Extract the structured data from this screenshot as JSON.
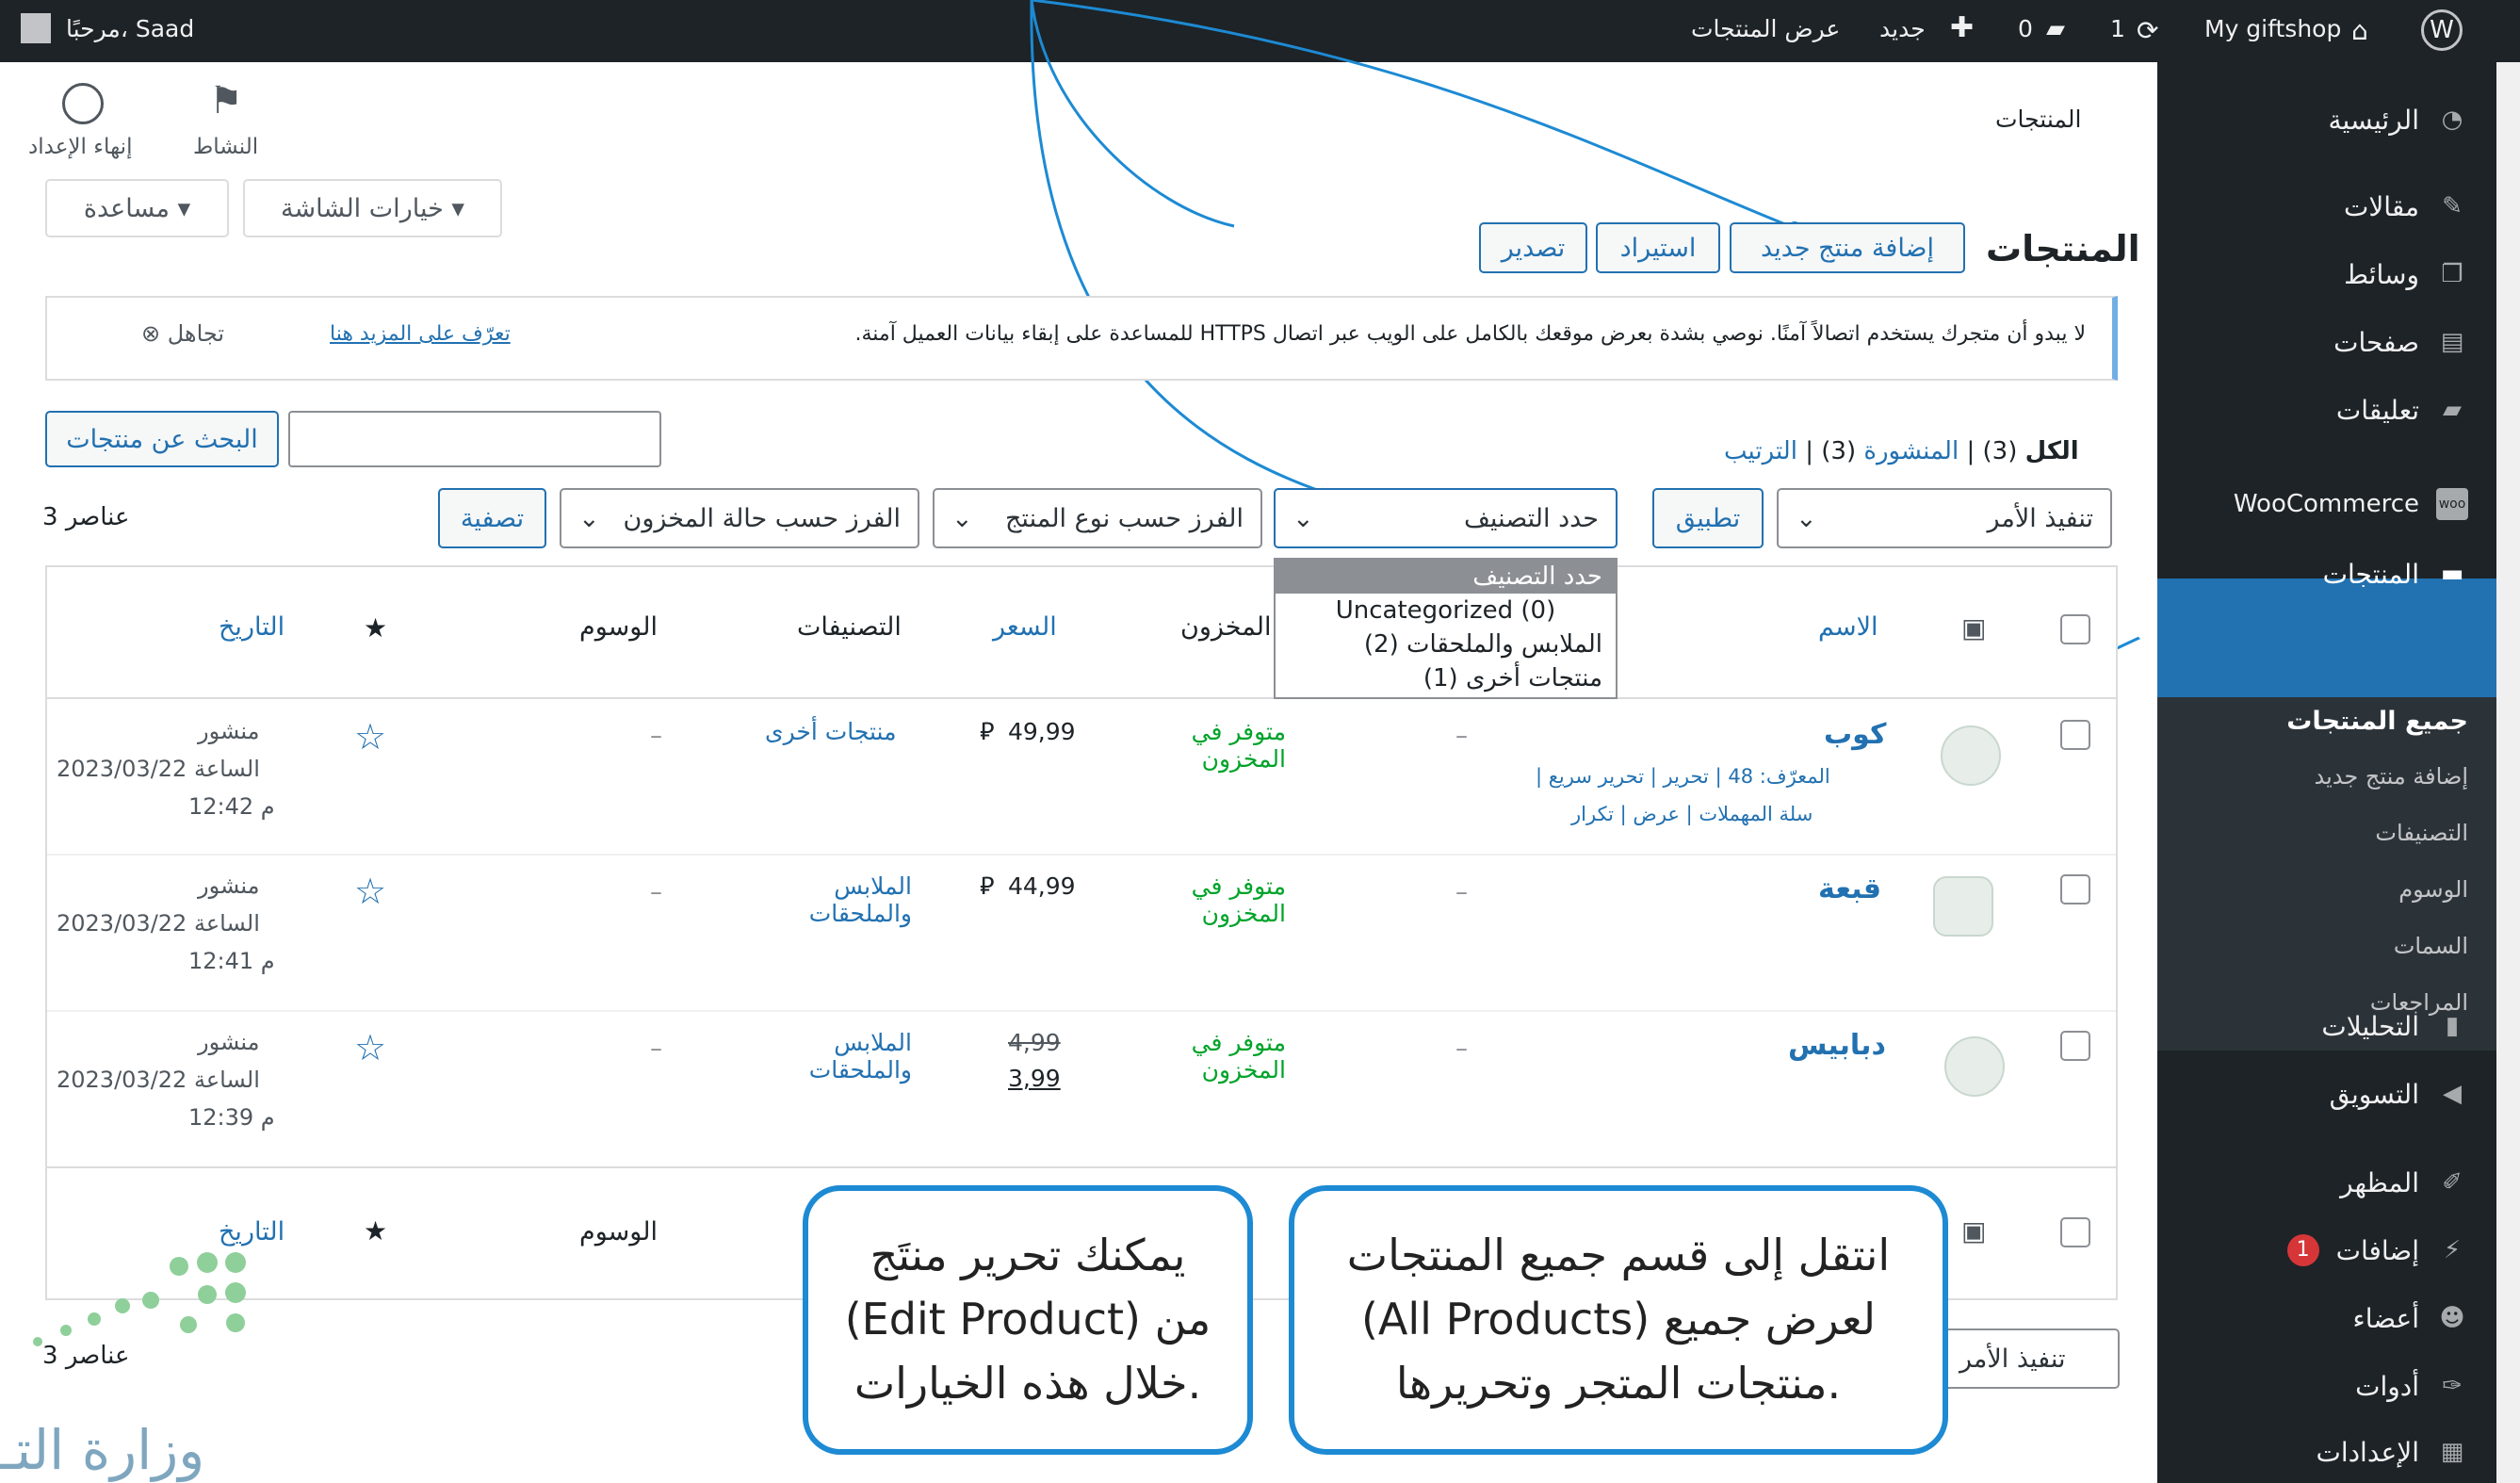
{
  "adminbar": {
    "wp_logo": "wordpress-icon",
    "site_name": "My giftshop",
    "updates": "1",
    "comments": "0",
    "new_label": "جديد",
    "view_products": "عرض المنتجات",
    "greeting": "مرحبًا، Saad"
  },
  "header": {
    "page_title": "المنتجات",
    "activity_label": "النشاط",
    "finish_setup_label": "إنهاء الإعداد",
    "screen_options": "خيارات الشاشة ▾",
    "help": "مساعدة ▾"
  },
  "main": {
    "heading": "المنتجات",
    "add_new": "إضافة منتج جديد",
    "import": "استيراد",
    "export": "تصدير",
    "notice_text": "لا يبدو أن متجرك يستخدم اتصالاً آمنًا. نوصي بشدة بعرض موقعك بالكامل على الويب عبر اتصال HTTPS للمساعدة على إبقاء بيانات العميل آمنة.",
    "notice_link": "تعرّف على المزيد هنا",
    "dismiss": "تجاهل",
    "search_button": "البحث عن منتجات",
    "search_value": "",
    "filter_all": "الكل",
    "filter_all_count": "(3)",
    "filter_published": "المنشورة",
    "filter_published_count": "(3)",
    "filter_sort": "الترتيب",
    "bulk_action": "تنفيذ الأمر",
    "apply": "تطبيق",
    "category_select": "حدد التصنيف",
    "type_select": "الفرز حسب نوع المنتج",
    "stock_select": "الفرز حسب حالة المخزون",
    "filter_button": "تصفية",
    "items_count": "3 عناصر",
    "items_count_bottom": "3 عناصر"
  },
  "dropdown": {
    "options": [
      {
        "label": "حدد التصنيف"
      },
      {
        "label": "Uncategorized  (0)"
      },
      {
        "label": "الملابس والملحقات  (2)"
      },
      {
        "label": "منتجات أخرى  (1)"
      }
    ]
  },
  "table": {
    "columns": {
      "name": "الاسم",
      "stock": "المخزون",
      "price": "السعر",
      "categories": "التصنيفات",
      "tags": "الوسوم",
      "date": "التاريخ"
    },
    "rows": [
      {
        "name": "كوب",
        "row_actions_1": "المعرّف: 48 | تحرير | تحرير سريع |",
        "row_actions_2": "سلة المهملات | عرض | تكرار",
        "sku": "–",
        "stock": "متوفر في المخزون",
        "price": "49,99",
        "category": "منتجات أخرى",
        "tags": "–",
        "status": "منشور",
        "date": "2023/03/22 الساعة",
        "time": "12:42 م"
      },
      {
        "name": "قبعة",
        "sku": "–",
        "stock": "متوفر في المخزون",
        "price": "44,99",
        "category": "الملابس والملحقات",
        "tags": "–",
        "status": "منشور",
        "date": "2023/03/22 الساعة",
        "time": "12:41 م"
      },
      {
        "name": "دبابيس",
        "sku": "–",
        "stock": "متوفر في المخزون",
        "price_old": "4,99",
        "price": "3,99",
        "category": "الملابس والملحقات",
        "tags": "–",
        "status": "منشور",
        "date": "2023/03/22 الساعة",
        "time": "12:39 م"
      }
    ],
    "currency_symbol": "⃁"
  },
  "sidebar": {
    "items": [
      {
        "label": "الرئيسية",
        "icon": "dashboard-icon"
      },
      {
        "label": "مقالات",
        "icon": "pin-icon"
      },
      {
        "label": "وسائط",
        "icon": "media-icon"
      },
      {
        "label": "صفحات",
        "icon": "pages-icon"
      },
      {
        "label": "تعليقات",
        "icon": "comment-icon"
      },
      {
        "label": "WooCommerce",
        "icon": "woo-icon"
      },
      {
        "label": "المنتجات",
        "icon": "products-icon"
      },
      {
        "label": "التحليلات",
        "icon": "analytics-icon"
      },
      {
        "label": "التسويق",
        "icon": "marketing-icon"
      },
      {
        "label": "المظهر",
        "icon": "appearance-icon"
      },
      {
        "label": "إضافات",
        "icon": "plugins-icon"
      },
      {
        "label": "أعضاء",
        "icon": "users-icon"
      },
      {
        "label": "أدوات",
        "icon": "tools-icon"
      },
      {
        "label": "الإعدادات",
        "icon": "settings-icon"
      }
    ],
    "plugins_badge": "1",
    "submenu": [
      {
        "label": "جميع المنتجات"
      },
      {
        "label": "إضافة منتج جديد"
      },
      {
        "label": "التصنيفات"
      },
      {
        "label": "الوسوم"
      },
      {
        "label": "السمات"
      },
      {
        "label": "المراجعات"
      }
    ]
  },
  "callouts": {
    "all_products_line1": "انتقل إلى قسم جميع المنتجات",
    "all_products_line2": "(All Products) لعرض جميع",
    "all_products_line3": "منتجات المتجر وتحريرها.",
    "edit_line1": "يمكنك تحرير منتَج",
    "edit_line2": "(Edit Product) من",
    "edit_line3": "خلال هذه الخيارات."
  },
  "watermark": "وزارة التـ",
  "colors": {
    "accent": "#2271b1",
    "sidebar": "#1d2327",
    "callout": "#1d8ad3",
    "in_stock": "#00a32a"
  }
}
